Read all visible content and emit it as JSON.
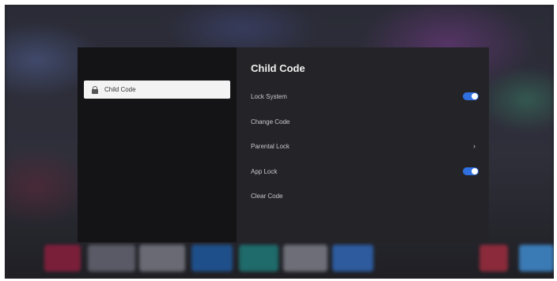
{
  "dialog": {
    "nav": [
      {
        "label": "Child Code",
        "icon": "lock-icon",
        "selected": true
      }
    ],
    "title": "Child Code",
    "rows": [
      {
        "label": "Lock System",
        "control": "toggle",
        "on": true
      },
      {
        "label": "Change Code",
        "control": "none"
      },
      {
        "label": "Parental Lock",
        "control": "chevron",
        "chevron": "›"
      },
      {
        "label": "App Lock",
        "control": "toggle",
        "on": true
      },
      {
        "label": "Clear Code",
        "control": "none"
      }
    ]
  },
  "colors": {
    "toggle_on": "#2f6fe0",
    "selected_item_bg": "#f3f3f3",
    "left_panel_bg": "#141417",
    "right_panel_bg": "#242428"
  }
}
